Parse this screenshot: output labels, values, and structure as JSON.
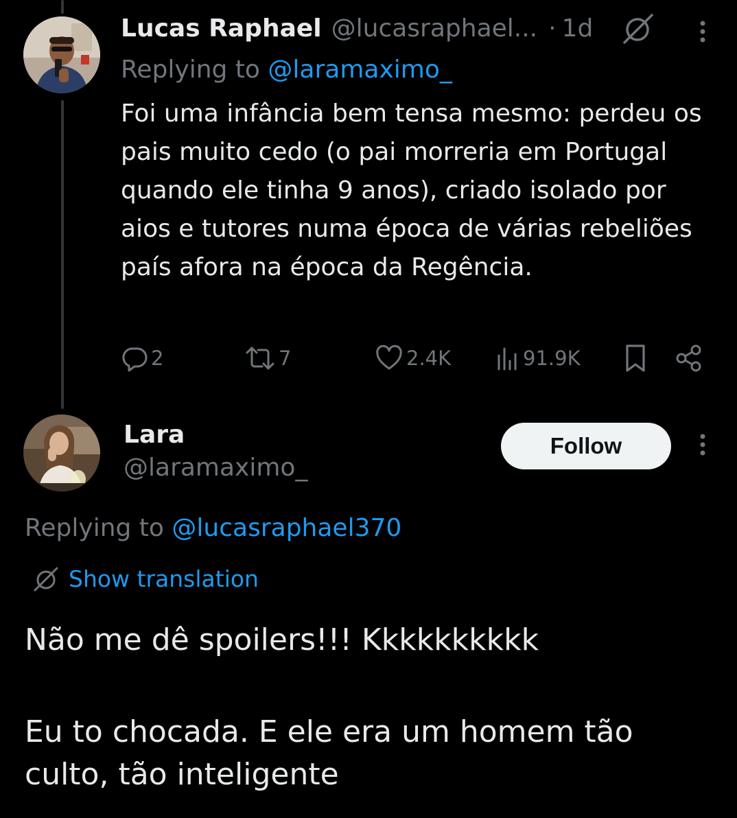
{
  "colors": {
    "background": "#000000",
    "text": "#e7e9ea",
    "muted": "#71767b",
    "link": "#1d9bf0",
    "follow_bg": "#eff3f4"
  },
  "tweet1": {
    "display_name": "Lucas Raphael",
    "handle": "@lucasraphael...",
    "dot": "·",
    "time": "1d",
    "replying_prefix": "Replying to ",
    "replying_handle": "@laramaximo_",
    "body": "Foi uma infância bem tensa mesmo: perdeu os pais muito cedo (o pai morreria em Portugal quando ele tinha 9 anos), criado isolado por aios e tutores numa época de várias rebeliões país afora na época da Regência.",
    "actions": {
      "replies": "2",
      "reposts": "7",
      "likes": "2.4K",
      "views": "91.9K"
    },
    "icons": [
      "translate-icon",
      "more-icon",
      "reply-icon",
      "repost-icon",
      "like-icon",
      "views-icon",
      "bookmark-icon",
      "share-icon"
    ]
  },
  "tweet2": {
    "display_name": "Lara",
    "handle": "@laramaximo_",
    "follow_label": "Follow",
    "replying_prefix": "Replying to ",
    "replying_handle": "@lucasraphael370",
    "translation_label": "Show translation",
    "body_line1": "Não me dê spoilers!!! Kkkkkkkkkk",
    "body_line2": "Eu to chocada. E ele era um homem tão culto, tão inteligente",
    "icons": [
      "translate-icon",
      "more-icon"
    ]
  }
}
